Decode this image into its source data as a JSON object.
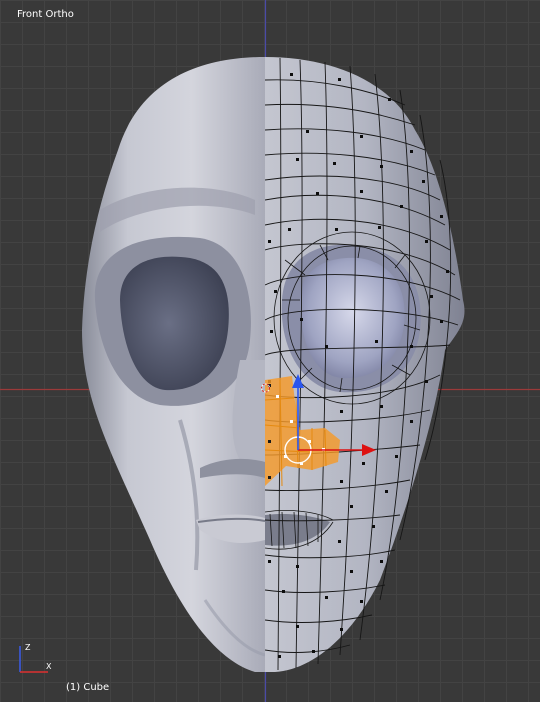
{
  "viewport": {
    "view_label": "Front Ortho",
    "object_label": "(1) Cube"
  },
  "gizmo": {
    "z_label": "Z",
    "x_label": "X"
  },
  "colors": {
    "background": "#393939",
    "grid": "#434343",
    "x_axis": "#9b3a3a",
    "z_axis": "#4a4aa8",
    "selection": "#f59a2a",
    "mesh_fill": "#b9bcc9",
    "mesh_shade": "#9599aa",
    "wire": "#1a1a1a",
    "manipulator_x": "#dd1111"
  }
}
